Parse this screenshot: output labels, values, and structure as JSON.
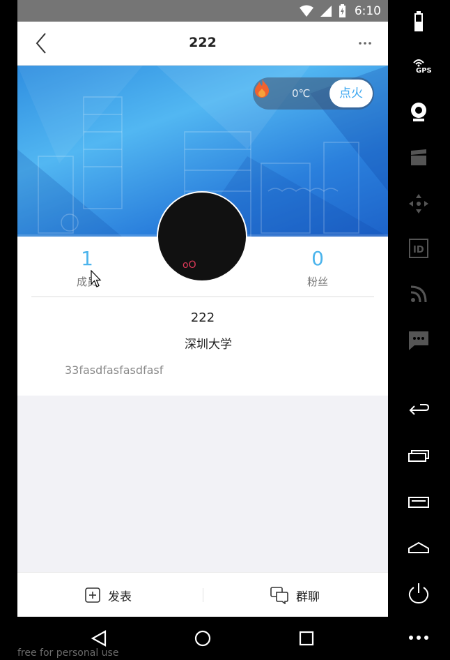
{
  "status_bar": {
    "time": "6:10"
  },
  "nav": {
    "title": "222"
  },
  "heat": {
    "temperature": "0℃",
    "ignite_label": "点火"
  },
  "stats": {
    "members_value": "1",
    "members_label": "成员",
    "fans_value": "0",
    "fans_label": "粉丝"
  },
  "avatar": {
    "text": "oO"
  },
  "group": {
    "name": "222",
    "school": "深圳大学",
    "description": "33fasdfasfasdfasf"
  },
  "bottom_bar": {
    "post_label": "发表",
    "chat_label": "群聊"
  },
  "watermark": "free for personal use",
  "side_panel": {
    "gps_label": "GPS",
    "id_label": "ID"
  },
  "colors": {
    "accent": "#4cb4ec",
    "banner": "#2f8ee0",
    "status_bar": "#757575"
  }
}
